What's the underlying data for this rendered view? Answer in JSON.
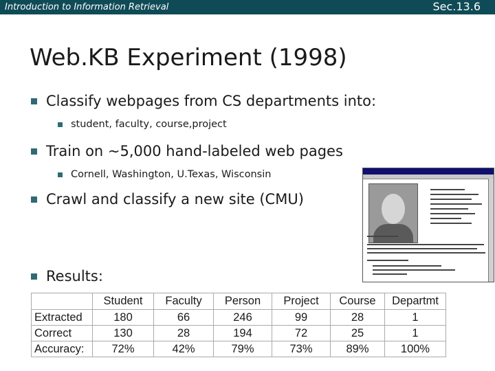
{
  "header": {
    "course": "Introduction to Information Retrieval",
    "section": "Sec.13.6",
    "bar_color": "#0f4b57"
  },
  "slide": {
    "title": "Web.KB Experiment (1998)",
    "bullets": [
      {
        "text": "Classify webpages from CS departments into:",
        "sub": [
          "student, faculty, course,project"
        ]
      },
      {
        "text": "Train on ~5,000 hand-labeled web pages",
        "sub": [
          "Cornell, Washington, U.Texas, Wisconsin"
        ]
      },
      {
        "text": "Crawl and classify a new site (CMU)",
        "sub": []
      },
      {
        "text": "Results:",
        "sub": []
      }
    ]
  },
  "results_table": {
    "columns": [
      "",
      "Student",
      "Faculty",
      "Person",
      "Project",
      "Course",
      "Departmt"
    ],
    "rows": [
      [
        "Extracted",
        "180",
        "66",
        "246",
        "99",
        "28",
        "1"
      ],
      [
        "Correct",
        "130",
        "28",
        "194",
        "72",
        "25",
        "1"
      ],
      [
        "Accuracy:",
        "72%",
        "42%",
        "79%",
        "73%",
        "89%",
        "100%"
      ]
    ]
  }
}
